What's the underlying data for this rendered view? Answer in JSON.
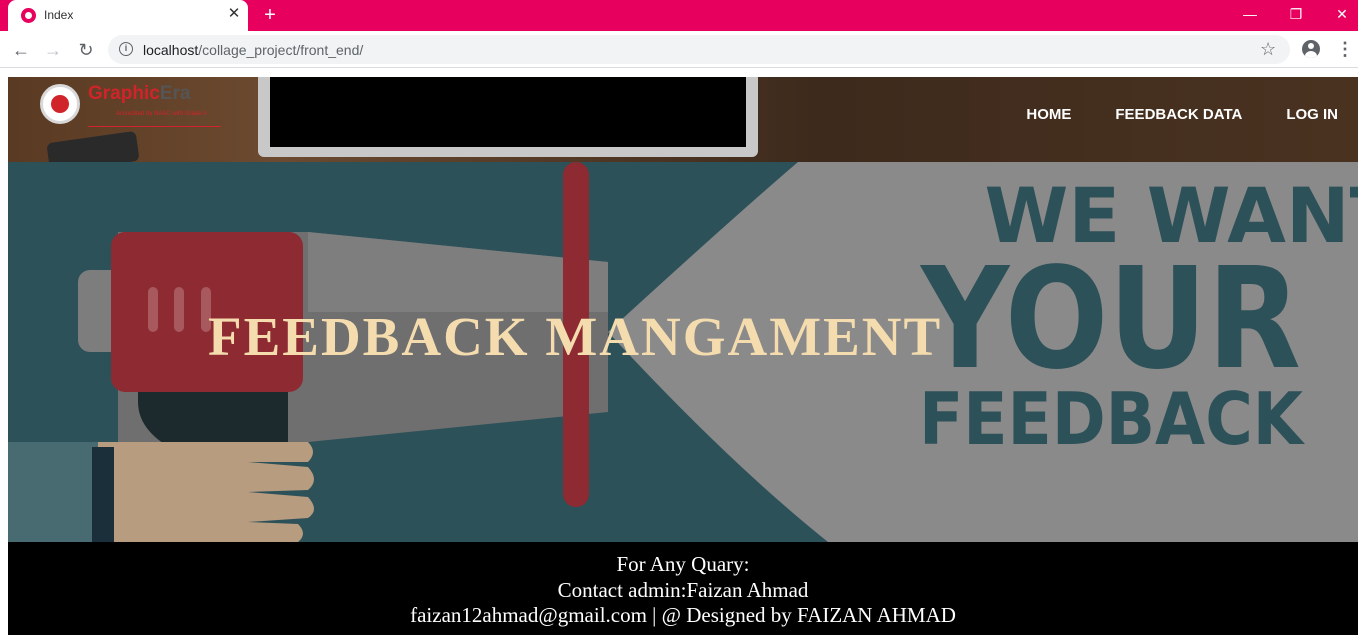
{
  "browser": {
    "tab_title": "Index",
    "tab_close": "✕",
    "new_tab": "+",
    "window_controls": {
      "minimize": "—",
      "restore": "❐",
      "close": "✕"
    },
    "nav": {
      "back": "←",
      "forward": "→",
      "reload": "↻"
    },
    "url_host": "localhost",
    "url_path": "/collage_project/front_end/",
    "info_icon": "i",
    "star_icon": "☆",
    "menu_icon": "⋮",
    "accent_color": "#e8005e"
  },
  "header": {
    "logo": {
      "name_primary": "Graphic",
      "name_secondary": "Era",
      "tagline": "Accredited by NAAC with Grade A"
    },
    "nav": [
      {
        "label": "HOME"
      },
      {
        "label": "FEEDBACK DATA"
      },
      {
        "label": "LOG IN"
      }
    ]
  },
  "hero": {
    "title": "FEEDBACK MANGAMENT",
    "poster": {
      "line1": "WE WANT",
      "line2": "YOUR",
      "line3": "FEEDBACK"
    }
  },
  "footer": {
    "line1": "For Any Quary:",
    "line2": "Contact admin:Faizan Ahmad",
    "line3": "faizan12ahmad@gmail.com | @ Designed by FAIZAN AHMAD"
  }
}
